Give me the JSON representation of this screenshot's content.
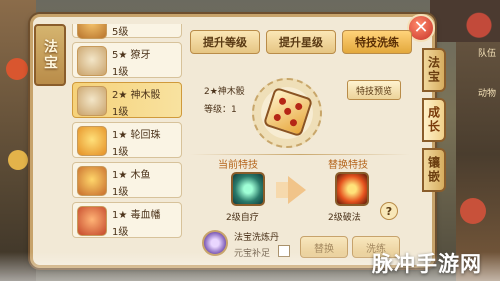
{
  "panel": {
    "title": "法宝",
    "close_symbol": "✕"
  },
  "list": [
    {
      "name": "5级",
      "level": ""
    },
    {
      "name": "5★ 獠牙",
      "level": "1级"
    },
    {
      "name": "2★ 神木骰",
      "level": "1级",
      "selected": true
    },
    {
      "name": "1★ 轮回珠",
      "level": "1级"
    },
    {
      "name": "1★ 木鱼",
      "level": "1级"
    },
    {
      "name": "1★ 毒血幡",
      "level": "1级"
    }
  ],
  "tabs": [
    {
      "label": "提升等级"
    },
    {
      "label": "提升星级"
    },
    {
      "label": "特技洗练",
      "active": true
    }
  ],
  "detail": {
    "name": "2★神木骰",
    "level": "等级：1",
    "preview_button": "特技预览",
    "current_label": "当前特技",
    "replace_label": "替换特技",
    "current_skill": "2级自疗",
    "replace_skill": "2级破法",
    "help_symbol": "?",
    "wash_item": "法宝洗炼丹",
    "yuanbao_label": "元宝补足",
    "replace_button": "替换",
    "wash_button": "洗练"
  },
  "side_tabs": [
    {
      "label": "法宝"
    },
    {
      "label": "成长",
      "active": true
    },
    {
      "label": "镶嵌"
    }
  ],
  "background": {
    "right_labels": [
      "队伍",
      "动物"
    ]
  },
  "watermark": "脉冲手游网",
  "colors": {
    "panel_bg": "#f2e9d6",
    "accent_gold": "#e3a83c",
    "border_brown": "#8a5d2b",
    "close_red": "#c7332a",
    "label_orange": "#b5651d"
  },
  "icons": [
    "close-icon",
    "dice-icon",
    "arrow-right-icon",
    "help-icon",
    "heal-skill-icon",
    "break-spell-skill-icon",
    "wash-pill-icon"
  ]
}
